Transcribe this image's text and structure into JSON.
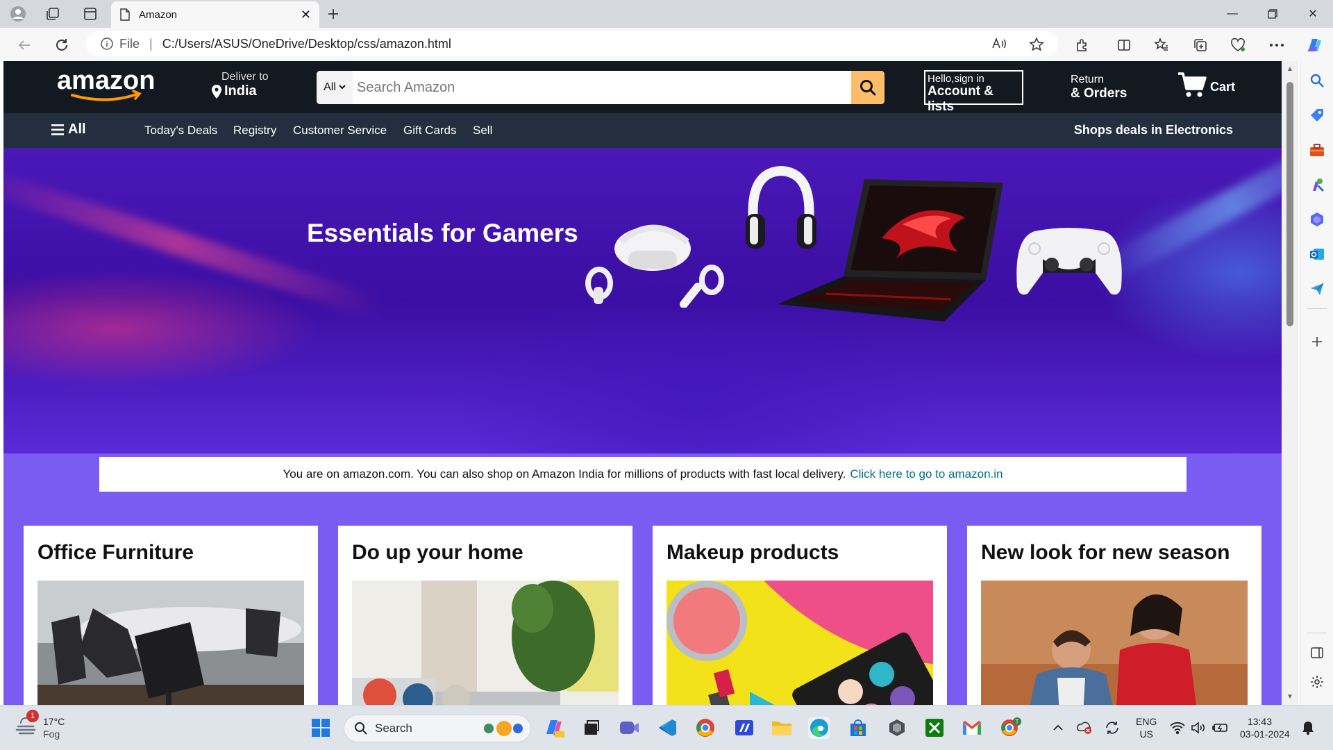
{
  "browser": {
    "tab_title": "Amazon",
    "address_prefix": "File",
    "url": "C:/Users/ASUS/OneDrive/Desktop/css/amazon.html"
  },
  "amazon": {
    "logo_text": "amazon",
    "deliver_label": "Deliver to",
    "deliver_location": "India",
    "search_category": "All",
    "search_placeholder": "Search Amazon",
    "account_line1": "Hello,sign in",
    "account_line2": "Account & lists",
    "returns_line1": "Return",
    "returns_line2": "& Orders",
    "cart_label": "Cart"
  },
  "subnav": {
    "all_label": "All",
    "items": [
      "Today's Deals",
      "Registry",
      "Customer Service",
      "Gift Cards",
      "Sell"
    ],
    "deals_label": "Shops deals in Electronics"
  },
  "hero": {
    "title": "Essentials for Gamers"
  },
  "notice": {
    "text": "You are on amazon.com. You can also shop on Amazon India for millions of products with fast local delivery.",
    "link": "Click here to go to amazon.in"
  },
  "cards": [
    {
      "title": "Office Furniture"
    },
    {
      "title": "Do up your home"
    },
    {
      "title": "Makeup products"
    },
    {
      "title": "New look for new season"
    }
  ],
  "taskbar": {
    "weather_temp": "17°C",
    "weather_desc": "Fog",
    "weather_badge": "1",
    "search_label": "Search",
    "lang_line1": "ENG",
    "lang_line2": "US",
    "time": "13:43",
    "date": "03-01-2024"
  },
  "colors": {
    "amazon_header": "#131921",
    "amazon_subnav": "#232f3e",
    "search_button": "#febd69",
    "page_background": "#7b5cf3",
    "link": "#007185"
  }
}
